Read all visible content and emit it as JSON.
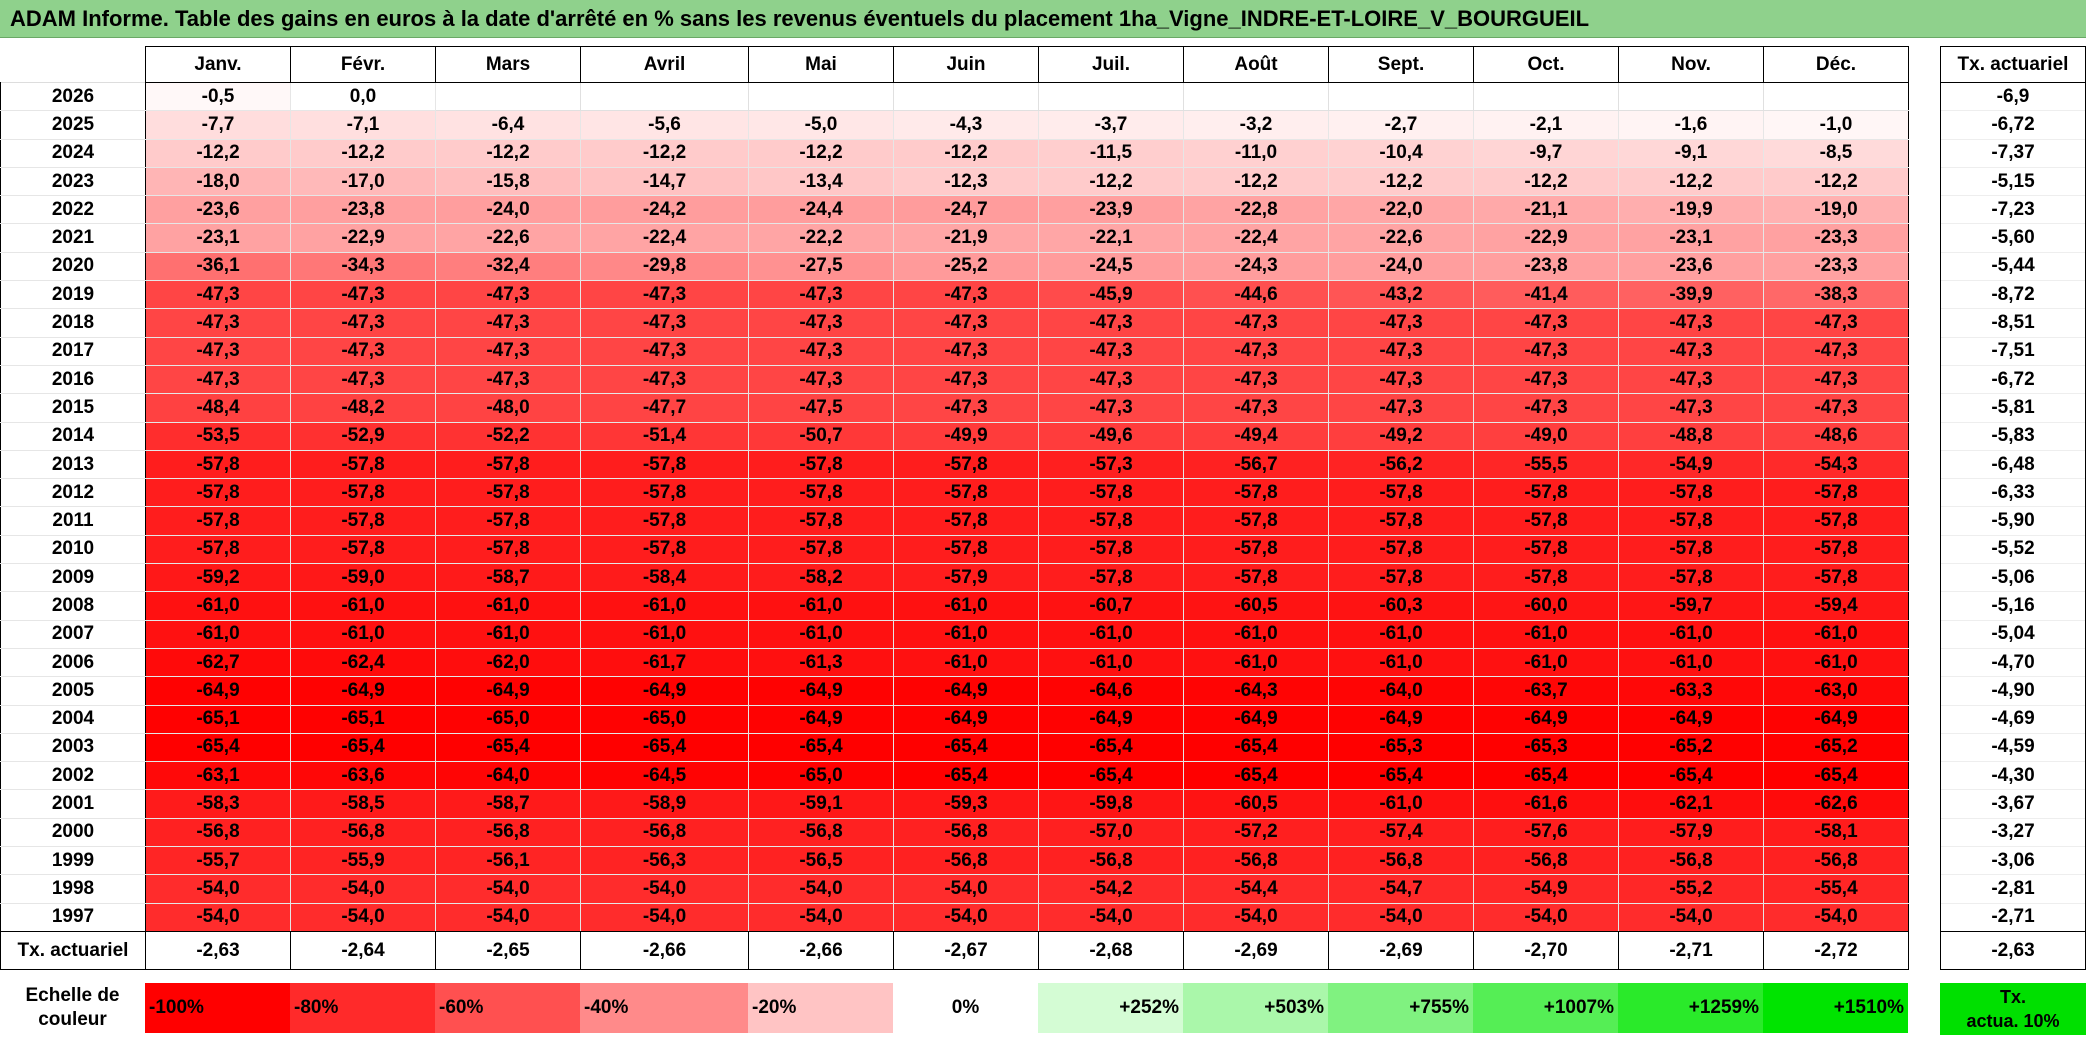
{
  "title": "ADAM Informe. Table des gains en euros à la date d'arrêté en % sans les revenus éventuels du placement 1ha_Vigne_INDRE-ET-LOIRE_V_BOURGUEIL",
  "months": [
    "Janv.",
    "Févr.",
    "Mars",
    "Avril",
    "Mai",
    "Juin",
    "Juil.",
    "Août",
    "Sept.",
    "Oct.",
    "Nov.",
    "Déc."
  ],
  "tx_header": "Tx. actuariel",
  "rows": [
    {
      "year": "2026",
      "vals": [
        "-0,5",
        "0,0",
        "",
        "",
        "",
        "",
        "",
        "",
        "",
        "",
        "",
        ""
      ],
      "tx": "-6,9"
    },
    {
      "year": "2025",
      "vals": [
        "-7,7",
        "-7,1",
        "-6,4",
        "-5,6",
        "-5,0",
        "-4,3",
        "-3,7",
        "-3,2",
        "-2,7",
        "-2,1",
        "-1,6",
        "-1,0"
      ],
      "tx": "-6,72"
    },
    {
      "year": "2024",
      "vals": [
        "-12,2",
        "-12,2",
        "-12,2",
        "-12,2",
        "-12,2",
        "-12,2",
        "-11,5",
        "-11,0",
        "-10,4",
        "-9,7",
        "-9,1",
        "-8,5"
      ],
      "tx": "-7,37"
    },
    {
      "year": "2023",
      "vals": [
        "-18,0",
        "-17,0",
        "-15,8",
        "-14,7",
        "-13,4",
        "-12,3",
        "-12,2",
        "-12,2",
        "-12,2",
        "-12,2",
        "-12,2",
        "-12,2"
      ],
      "tx": "-5,15"
    },
    {
      "year": "2022",
      "vals": [
        "-23,6",
        "-23,8",
        "-24,0",
        "-24,2",
        "-24,4",
        "-24,7",
        "-23,9",
        "-22,8",
        "-22,0",
        "-21,1",
        "-19,9",
        "-19,0"
      ],
      "tx": "-7,23"
    },
    {
      "year": "2021",
      "vals": [
        "-23,1",
        "-22,9",
        "-22,6",
        "-22,4",
        "-22,2",
        "-21,9",
        "-22,1",
        "-22,4",
        "-22,6",
        "-22,9",
        "-23,1",
        "-23,3"
      ],
      "tx": "-5,60"
    },
    {
      "year": "2020",
      "vals": [
        "-36,1",
        "-34,3",
        "-32,4",
        "-29,8",
        "-27,5",
        "-25,2",
        "-24,5",
        "-24,3",
        "-24,0",
        "-23,8",
        "-23,6",
        "-23,3"
      ],
      "tx": "-5,44"
    },
    {
      "year": "2019",
      "vals": [
        "-47,3",
        "-47,3",
        "-47,3",
        "-47,3",
        "-47,3",
        "-47,3",
        "-45,9",
        "-44,6",
        "-43,2",
        "-41,4",
        "-39,9",
        "-38,3"
      ],
      "tx": "-8,72"
    },
    {
      "year": "2018",
      "vals": [
        "-47,3",
        "-47,3",
        "-47,3",
        "-47,3",
        "-47,3",
        "-47,3",
        "-47,3",
        "-47,3",
        "-47,3",
        "-47,3",
        "-47,3",
        "-47,3"
      ],
      "tx": "-8,51"
    },
    {
      "year": "2017",
      "vals": [
        "-47,3",
        "-47,3",
        "-47,3",
        "-47,3",
        "-47,3",
        "-47,3",
        "-47,3",
        "-47,3",
        "-47,3",
        "-47,3",
        "-47,3",
        "-47,3"
      ],
      "tx": "-7,51"
    },
    {
      "year": "2016",
      "vals": [
        "-47,3",
        "-47,3",
        "-47,3",
        "-47,3",
        "-47,3",
        "-47,3",
        "-47,3",
        "-47,3",
        "-47,3",
        "-47,3",
        "-47,3",
        "-47,3"
      ],
      "tx": "-6,72"
    },
    {
      "year": "2015",
      "vals": [
        "-48,4",
        "-48,2",
        "-48,0",
        "-47,7",
        "-47,5",
        "-47,3",
        "-47,3",
        "-47,3",
        "-47,3",
        "-47,3",
        "-47,3",
        "-47,3"
      ],
      "tx": "-5,81"
    },
    {
      "year": "2014",
      "vals": [
        "-53,5",
        "-52,9",
        "-52,2",
        "-51,4",
        "-50,7",
        "-49,9",
        "-49,6",
        "-49,4",
        "-49,2",
        "-49,0",
        "-48,8",
        "-48,6"
      ],
      "tx": "-5,83"
    },
    {
      "year": "2013",
      "vals": [
        "-57,8",
        "-57,8",
        "-57,8",
        "-57,8",
        "-57,8",
        "-57,8",
        "-57,3",
        "-56,7",
        "-56,2",
        "-55,5",
        "-54,9",
        "-54,3"
      ],
      "tx": "-6,48"
    },
    {
      "year": "2012",
      "vals": [
        "-57,8",
        "-57,8",
        "-57,8",
        "-57,8",
        "-57,8",
        "-57,8",
        "-57,8",
        "-57,8",
        "-57,8",
        "-57,8",
        "-57,8",
        "-57,8"
      ],
      "tx": "-6,33"
    },
    {
      "year": "2011",
      "vals": [
        "-57,8",
        "-57,8",
        "-57,8",
        "-57,8",
        "-57,8",
        "-57,8",
        "-57,8",
        "-57,8",
        "-57,8",
        "-57,8",
        "-57,8",
        "-57,8"
      ],
      "tx": "-5,90"
    },
    {
      "year": "2010",
      "vals": [
        "-57,8",
        "-57,8",
        "-57,8",
        "-57,8",
        "-57,8",
        "-57,8",
        "-57,8",
        "-57,8",
        "-57,8",
        "-57,8",
        "-57,8",
        "-57,8"
      ],
      "tx": "-5,52"
    },
    {
      "year": "2009",
      "vals": [
        "-59,2",
        "-59,0",
        "-58,7",
        "-58,4",
        "-58,2",
        "-57,9",
        "-57,8",
        "-57,8",
        "-57,8",
        "-57,8",
        "-57,8",
        "-57,8"
      ],
      "tx": "-5,06"
    },
    {
      "year": "2008",
      "vals": [
        "-61,0",
        "-61,0",
        "-61,0",
        "-61,0",
        "-61,0",
        "-61,0",
        "-60,7",
        "-60,5",
        "-60,3",
        "-60,0",
        "-59,7",
        "-59,4"
      ],
      "tx": "-5,16"
    },
    {
      "year": "2007",
      "vals": [
        "-61,0",
        "-61,0",
        "-61,0",
        "-61,0",
        "-61,0",
        "-61,0",
        "-61,0",
        "-61,0",
        "-61,0",
        "-61,0",
        "-61,0",
        "-61,0"
      ],
      "tx": "-5,04"
    },
    {
      "year": "2006",
      "vals": [
        "-62,7",
        "-62,4",
        "-62,0",
        "-61,7",
        "-61,3",
        "-61,0",
        "-61,0",
        "-61,0",
        "-61,0",
        "-61,0",
        "-61,0",
        "-61,0"
      ],
      "tx": "-4,70"
    },
    {
      "year": "2005",
      "vals": [
        "-64,9",
        "-64,9",
        "-64,9",
        "-64,9",
        "-64,9",
        "-64,9",
        "-64,6",
        "-64,3",
        "-64,0",
        "-63,7",
        "-63,3",
        "-63,0"
      ],
      "tx": "-4,90"
    },
    {
      "year": "2004",
      "vals": [
        "-65,1",
        "-65,1",
        "-65,0",
        "-65,0",
        "-64,9",
        "-64,9",
        "-64,9",
        "-64,9",
        "-64,9",
        "-64,9",
        "-64,9",
        "-64,9"
      ],
      "tx": "-4,69"
    },
    {
      "year": "2003",
      "vals": [
        "-65,4",
        "-65,4",
        "-65,4",
        "-65,4",
        "-65,4",
        "-65,4",
        "-65,4",
        "-65,4",
        "-65,3",
        "-65,3",
        "-65,2",
        "-65,2"
      ],
      "tx": "-4,59"
    },
    {
      "year": "2002",
      "vals": [
        "-63,1",
        "-63,6",
        "-64,0",
        "-64,5",
        "-65,0",
        "-65,4",
        "-65,4",
        "-65,4",
        "-65,4",
        "-65,4",
        "-65,4",
        "-65,4"
      ],
      "tx": "-4,30"
    },
    {
      "year": "2001",
      "vals": [
        "-58,3",
        "-58,5",
        "-58,7",
        "-58,9",
        "-59,1",
        "-59,3",
        "-59,8",
        "-60,5",
        "-61,0",
        "-61,6",
        "-62,1",
        "-62,6"
      ],
      "tx": "-3,67"
    },
    {
      "year": "2000",
      "vals": [
        "-56,8",
        "-56,8",
        "-56,8",
        "-56,8",
        "-56,8",
        "-56,8",
        "-57,0",
        "-57,2",
        "-57,4",
        "-57,6",
        "-57,9",
        "-58,1"
      ],
      "tx": "-3,27"
    },
    {
      "year": "1999",
      "vals": [
        "-55,7",
        "-55,9",
        "-56,1",
        "-56,3",
        "-56,5",
        "-56,8",
        "-56,8",
        "-56,8",
        "-56,8",
        "-56,8",
        "-56,8",
        "-56,8"
      ],
      "tx": "-3,06"
    },
    {
      "year": "1998",
      "vals": [
        "-54,0",
        "-54,0",
        "-54,0",
        "-54,0",
        "-54,0",
        "-54,0",
        "-54,2",
        "-54,4",
        "-54,7",
        "-54,9",
        "-55,2",
        "-55,4"
      ],
      "tx": "-2,81"
    },
    {
      "year": "1997",
      "vals": [
        "-54,0",
        "-54,0",
        "-54,0",
        "-54,0",
        "-54,0",
        "-54,0",
        "-54,0",
        "-54,0",
        "-54,0",
        "-54,0",
        "-54,0",
        "-54,0"
      ],
      "tx": "-2,71"
    }
  ],
  "footer": {
    "label": "Tx. actuariel",
    "vals": [
      "-2,63",
      "-2,64",
      "-2,65",
      "-2,66",
      "-2,66",
      "-2,67",
      "-2,68",
      "-2,69",
      "-2,69",
      "-2,70",
      "-2,71",
      "-2,72"
    ],
    "tx": "-2,63"
  },
  "scale": {
    "label_line1": "Echelle de",
    "label_line2": "couleur",
    "items": [
      {
        "text": "-100%",
        "color": "#ff0000",
        "align": "left"
      },
      {
        "text": "-80%",
        "color": "#ff2a2a",
        "align": "left"
      },
      {
        "text": "-60%",
        "color": "#ff5050",
        "align": "left"
      },
      {
        "text": "-40%",
        "color": "#ff8a8a",
        "align": "left"
      },
      {
        "text": "-20%",
        "color": "#ffc4c4",
        "align": "left"
      },
      {
        "text": "0%",
        "color": "#ffffff",
        "align": "center"
      },
      {
        "text": "+252%",
        "color": "#d4fcd4",
        "align": "right"
      },
      {
        "text": "+503%",
        "color": "#aaf7aa",
        "align": "right"
      },
      {
        "text": "+755%",
        "color": "#80f280",
        "align": "right"
      },
      {
        "text": "+1007%",
        "color": "#55ee55",
        "align": "right"
      },
      {
        "text": "+1259%",
        "color": "#2aea2a",
        "align": "right"
      },
      {
        "text": "+1510%",
        "color": "#00e400",
        "align": "right"
      }
    ],
    "legend_line1": "Tx.",
    "legend_line2": "actua. 10%"
  }
}
